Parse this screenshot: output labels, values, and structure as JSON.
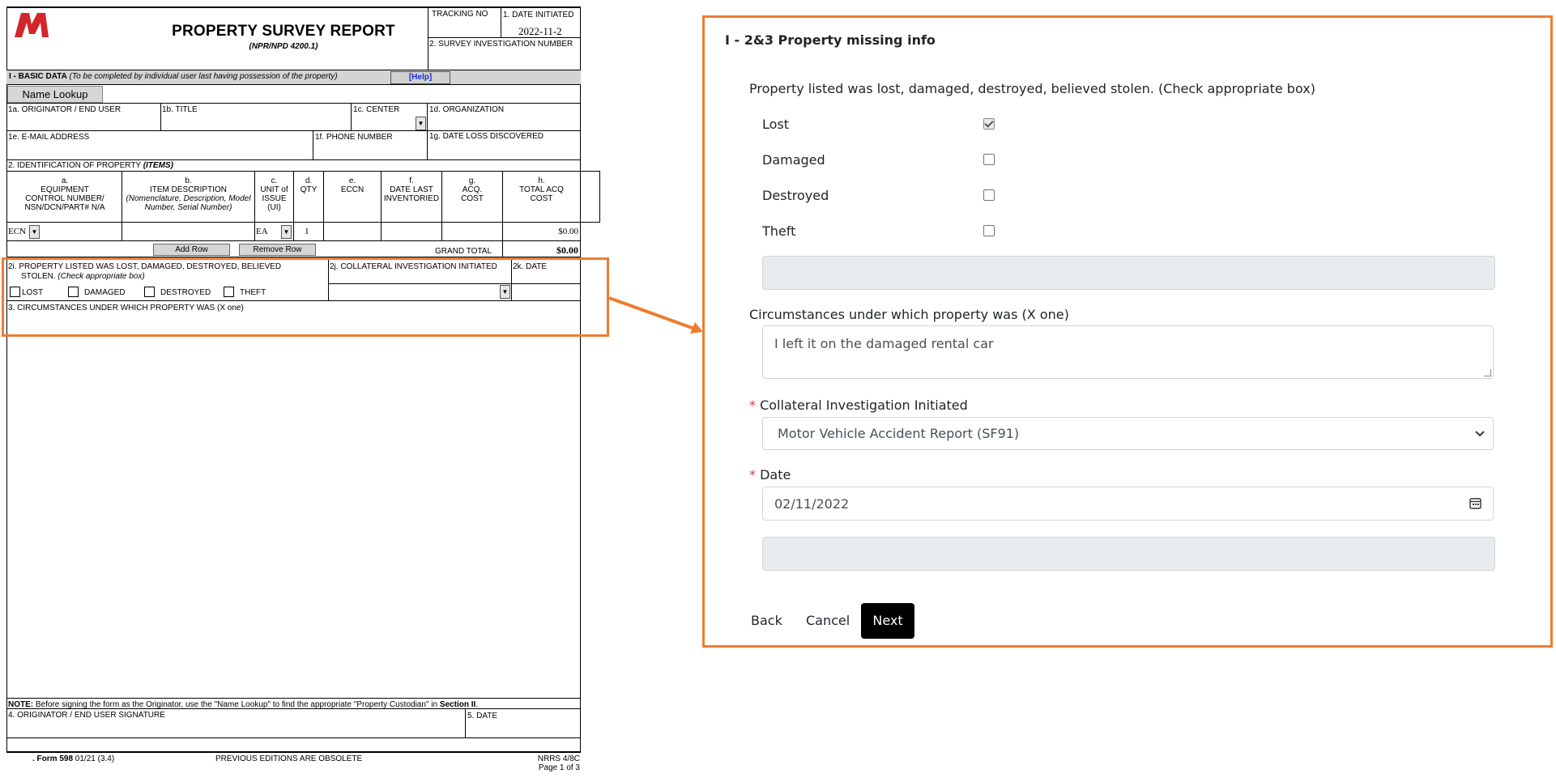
{
  "form": {
    "logo_text": "M",
    "title": "PROPERTY SURVEY REPORT",
    "subtitle": "(NPR/NPD 4200.1)",
    "tracking_label": "TRACKING NO",
    "date_initiated_label": "1. DATE INITIATED",
    "date_initiated_value": "2022-11-2",
    "survey_number_label": "2. SURVEY INVESTIGATION NUMBER",
    "basic_data_label": "I - BASIC DATA",
    "basic_data_note": "(To be completed by individual user last having possession of the property)",
    "help_label": "[Help]",
    "name_lookup_label": "Name Lookup",
    "originator_label": "1a. ORIGINATOR / END USER",
    "title_label": "1b. TITLE",
    "center_label": "1c. CENTER",
    "organization_label": "1d. ORGANIZATION",
    "email_label": "1e. E-MAIL ADDRESS",
    "phone_label": "1f. PHONE NUMBER",
    "date_loss_label": "1g. DATE LOSS DISCOVERED",
    "identification_label": "2. IDENTIFICATION OF PROPERTY",
    "identification_items": "(ITEMS)",
    "columns": [
      {
        "letter": "a.",
        "lines": [
          "EQUIPMENT",
          "CONTROL NUMBER/",
          "NSN/DCN/PART# N/A"
        ]
      },
      {
        "letter": "b.",
        "lines": [
          "ITEM DESCRIPTION",
          "(Nomenclature, Description, Model",
          "Number, Serial Number)"
        ]
      },
      {
        "letter": "c.",
        "lines": [
          "UNIT of",
          "ISSUE",
          "(UI)"
        ]
      },
      {
        "letter": "d.",
        "lines": [
          "QTY"
        ]
      },
      {
        "letter": "e.",
        "lines": [
          "ECCN"
        ]
      },
      {
        "letter": "f.",
        "lines": [
          "DATE LAST",
          "INVENTORIED"
        ]
      },
      {
        "letter": "g.",
        "lines": [
          "ACQ.",
          "COST"
        ]
      },
      {
        "letter": "h.",
        "lines": [
          "TOTAL ACQ",
          "COST"
        ]
      }
    ],
    "row": {
      "ecn": "ECN",
      "ui": "EA",
      "qty": "1",
      "total": "$0.00"
    },
    "add_row_label": "Add Row",
    "remove_row_label": "Remove Row",
    "grand_total_label": "GRAND TOTAL",
    "grand_total_value": "$0.00",
    "section_2i_label": "2i. PROPERTY LISTED WAS LOST, DAMAGED, DESTROYED, BELIEVED",
    "section_2i_label2": "STOLEN.",
    "section_2i_note": "(Check appropriate box)",
    "section_2j_label": "2j. COLLATERAL INVESTIGATION INITIATED",
    "section_2k_label": "2k. DATE",
    "cb_lost": "LOST",
    "cb_damaged": "DAMAGED",
    "cb_destroyed": "DESTROYED",
    "cb_theft": "THEFT",
    "circumstances_label": "3. CIRCUMSTANCES UNDER WHICH PROPERTY WAS (X one)",
    "note_prefix": "NOTE:",
    "note_text": " Before signing the form as the Originator, use the \"Name Lookup\" to find the appropriate \"Property Custodian\" in ",
    "note_section": "Section II",
    "note_end": ".",
    "signature_label": "4. ORIGINATOR / END USER SIGNATURE",
    "sig_date_label": "5. DATE",
    "footer_form": ". Form 598",
    "footer_version": " 01/21  (3.4)",
    "footer_middle": "PREVIOUS EDITIONS ARE OBSOLETE",
    "footer_right1": "NRRS 4/8C",
    "footer_right2": "Page 1 of 3"
  },
  "panel": {
    "title": "I - 2&3 Property missing info",
    "question": "Property listed was lost, damaged, destroyed, believed stolen. (Check appropriate box)",
    "options": [
      {
        "label": "Lost",
        "checked": true
      },
      {
        "label": "Damaged",
        "checked": false
      },
      {
        "label": "Destroyed",
        "checked": false
      },
      {
        "label": "Theft",
        "checked": false
      }
    ],
    "circumstances_label": "Circumstances under which property was (X one)",
    "circumstances_value": "I left it on the damaged rental car",
    "required_mark": "*",
    "collateral_label": "Collateral Investigation Initiated",
    "collateral_value": "Motor Vehicle Accident Report (SF91)",
    "date_label": "Date",
    "date_value": "02/11/2022",
    "back_label": "Back",
    "cancel_label": "Cancel",
    "next_label": "Next"
  },
  "colors": {
    "highlight": "#ed7d31",
    "logo": "#d1262b",
    "help_link": "#1a2fd0",
    "required": "#dc3545"
  }
}
